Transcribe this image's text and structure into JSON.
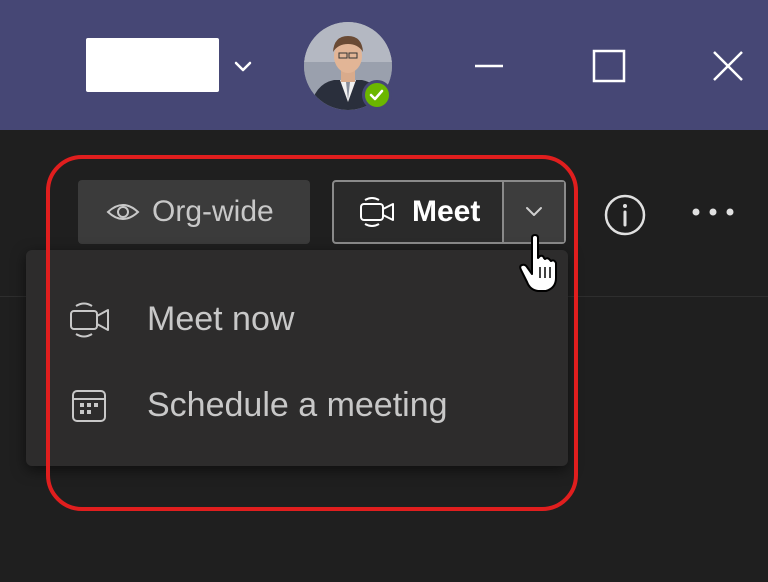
{
  "window": {
    "org_switcher": {
      "icon": "chevron-down-icon"
    },
    "avatar": {
      "status": "available",
      "status_color": "#6bb700"
    },
    "controls": {
      "minimize_icon": "minimize-icon",
      "maximize_icon": "maximize-icon",
      "close_icon": "close-icon"
    },
    "accent_color": "#464775"
  },
  "toolbar": {
    "privacy": {
      "label": "Org-wide",
      "icon": "eye-icon"
    },
    "meet": {
      "label": "Meet",
      "icon": "video-camera-icon",
      "dropdown_icon": "chevron-down-icon"
    },
    "info_icon": "info-icon",
    "more_icon": "more-horizontal-icon"
  },
  "meet_menu": {
    "items": [
      {
        "label": "Meet now",
        "icon": "video-camera-icon"
      },
      {
        "label": "Schedule a meeting",
        "icon": "calendar-icon"
      }
    ]
  },
  "annotation": {
    "highlight_color": "#e01e1e"
  }
}
